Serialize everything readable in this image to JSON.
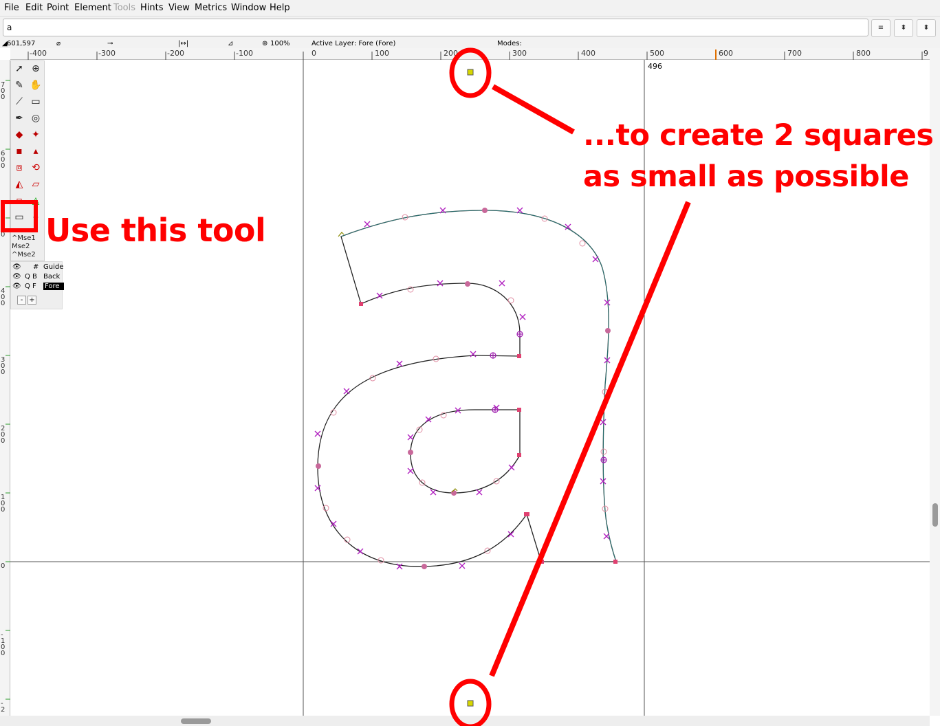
{
  "menubar": {
    "items": [
      {
        "label": "File"
      },
      {
        "label": "Edit"
      },
      {
        "label": "Point"
      },
      {
        "label": "Element"
      },
      {
        "label": "Tools",
        "disabled": true
      },
      {
        "label": "Hints"
      },
      {
        "label": "View"
      },
      {
        "label": "Metrics"
      },
      {
        "label": "Window"
      },
      {
        "label": "Help"
      }
    ]
  },
  "toolbar": {
    "glyph_value": "a",
    "btn_list": "≡",
    "btn_up": "⬍",
    "btn_down": "⬍"
  },
  "info": {
    "coords": "601,597",
    "zoom": "100%",
    "active_layer": "Active Layer: Fore (Fore)",
    "modes": "Modes:",
    "width_marker": "496"
  },
  "ruler": {
    "h_labels": [
      "-400",
      "-300",
      "-200",
      "-100",
      "0",
      "100",
      "200",
      "300",
      "400",
      "500",
      "600",
      "700",
      "800",
      "9"
    ],
    "v_labels": [
      "7\n0\n0",
      "6\n0\n0",
      "5\n0\n0",
      "4\n0\n0",
      "3\n0\n0",
      "2\n0\n0",
      "1\n0\n0",
      "0",
      "-\n1\n0\n0",
      "-\n2"
    ]
  },
  "palette": {
    "mouse": [
      "^Mse1",
      "Mse2",
      "^Mse2"
    ]
  },
  "layers": {
    "rows": [
      {
        "mark": "#",
        "name": "Guide"
      },
      {
        "mark": "Q B",
        "name": "Back"
      },
      {
        "mark": "Q F",
        "name": "Fore"
      }
    ],
    "minus": "-",
    "plus": "+"
  },
  "annotations": {
    "use_tool": "Use this tool",
    "line1": "...to create 2 squares",
    "line2": "as small as possible",
    "color": "#ff0000"
  }
}
